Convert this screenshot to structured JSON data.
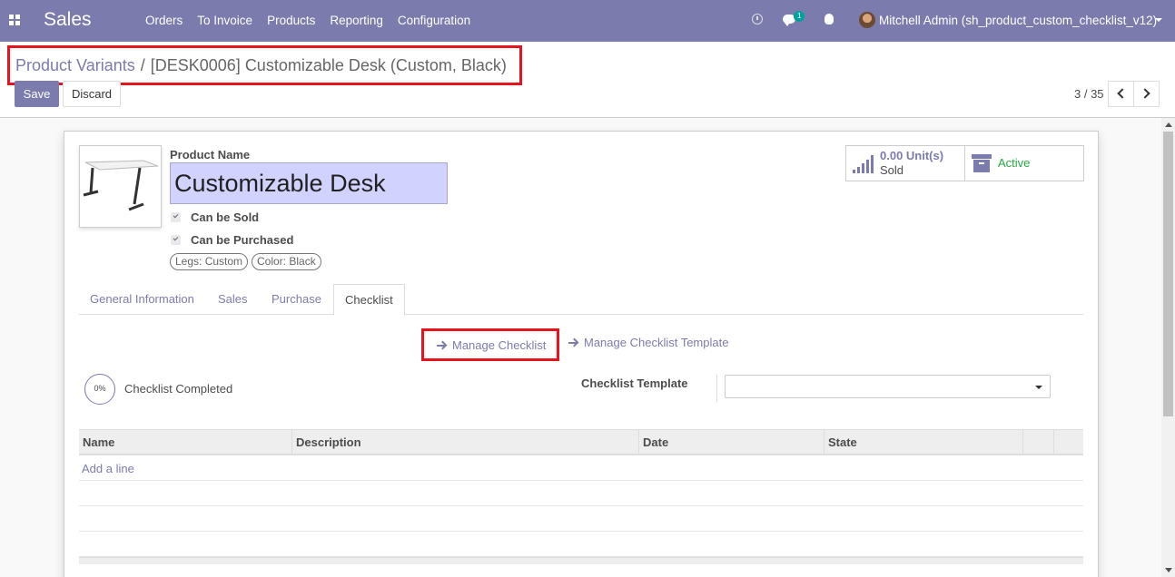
{
  "navbar": {
    "brand": "Sales",
    "menu": [
      "Orders",
      "To Invoice",
      "Products",
      "Reporting",
      "Configuration"
    ],
    "chat_badge": "1",
    "user_name": "Mitchell Admin (sh_product_custom_checklist_v12)",
    "icons": [
      "apps-icon",
      "clock-icon",
      "chat-icon",
      "bug-icon",
      "avatar",
      "caret-down-icon"
    ]
  },
  "breadcrumb": {
    "parent": "Product Variants",
    "separator": "/",
    "current": "[DESK0006] Customizable Desk (Custom, Black)"
  },
  "actions": {
    "save": "Save",
    "discard": "Discard"
  },
  "pager": {
    "value": "3 / 35"
  },
  "form": {
    "product_name_label": "Product Name",
    "product_name": "Customizable Desk",
    "can_be_sold": "Can be Sold",
    "can_be_purchased": "Can be Purchased",
    "tags": [
      "Legs: Custom",
      "Color: Black"
    ]
  },
  "stats": {
    "sold_value": "0.00 Unit(s)",
    "sold_label": "Sold",
    "active_label": "Active"
  },
  "tabs": [
    "General Information",
    "Sales",
    "Purchase",
    "Checklist"
  ],
  "checklist": {
    "manage_checklist": "Manage Checklist",
    "manage_template": "Manage Checklist Template",
    "progress": "0%",
    "progress_label": "Checklist Completed",
    "template_label": "Checklist Template",
    "template_value": "",
    "columns": [
      "Name",
      "Description",
      "Date",
      "State"
    ],
    "add_line": "Add a line"
  },
  "colors": {
    "brand": "#7c7bad",
    "highlight": "#e5141c",
    "active": "#28a745",
    "input_bg": "#d2d2ff"
  }
}
